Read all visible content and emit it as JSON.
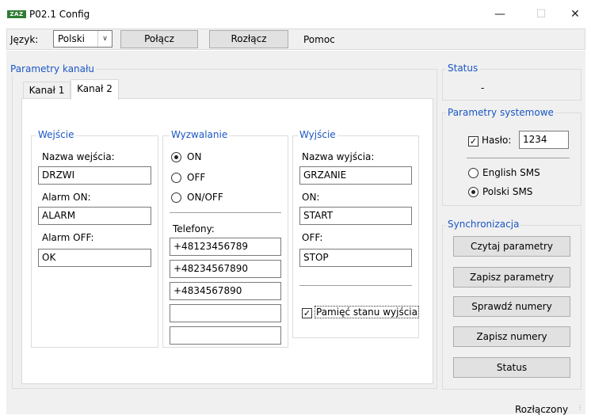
{
  "window": {
    "logo_text": "ZAZ",
    "title": "P02.1 Config",
    "minimize": "—",
    "maximize": "☐",
    "close": "✕"
  },
  "toolbar": {
    "language_label": "Język:",
    "language_value": "Polski",
    "connect_label": "Połącz",
    "disconnect_label": "Rozłącz",
    "help_label": "Pomoc"
  },
  "channel": {
    "group_title": "Parametry kanału",
    "tabs": [
      {
        "label": "Kanał 1",
        "active": false
      },
      {
        "label": "Kanał 2",
        "active": true
      }
    ],
    "input": {
      "title": "Wejście",
      "name_label": "Nazwa wejścia:",
      "name_value": "DRZWI",
      "alarm_on_label": "Alarm ON:",
      "alarm_on_value": "ALARM",
      "alarm_off_label": "Alarm OFF:",
      "alarm_off_value": "OK"
    },
    "trigger": {
      "title": "Wyzwalanie",
      "options": [
        {
          "label": "ON",
          "selected": true
        },
        {
          "label": "OFF",
          "selected": false
        },
        {
          "label": "ON/OFF",
          "selected": false
        }
      ],
      "phones_label": "Telefony:",
      "phones": [
        "+48123456789",
        "+48234567890",
        "+4834567890",
        "",
        ""
      ]
    },
    "output": {
      "title": "Wyjście",
      "name_label": "Nazwa wyjścia:",
      "name_value": "GRZANIE",
      "on_label": "ON:",
      "on_value": "START",
      "off_label": "OFF:",
      "off_value": "STOP",
      "memory_label": "Pamięć stanu wyjścia",
      "memory_checked": true
    }
  },
  "status": {
    "title": "Status",
    "value": "-"
  },
  "system": {
    "title": "Parametry systemowe",
    "password_label": "Hasło:",
    "password_checked": true,
    "password_value": "1234",
    "sms_options": [
      {
        "label": "English SMS",
        "selected": false
      },
      {
        "label": "Polski SMS",
        "selected": true
      }
    ]
  },
  "sync": {
    "title": "Synchronizacja",
    "buttons": [
      "Czytaj parametry",
      "Zapisz parametry",
      "Sprawdź numery",
      "Zapisz numery",
      "Status"
    ]
  },
  "statusbar": {
    "connection": "Rozłączony"
  },
  "colors": {
    "group_title": "#1a56c4",
    "background": "#f0f0f0"
  }
}
